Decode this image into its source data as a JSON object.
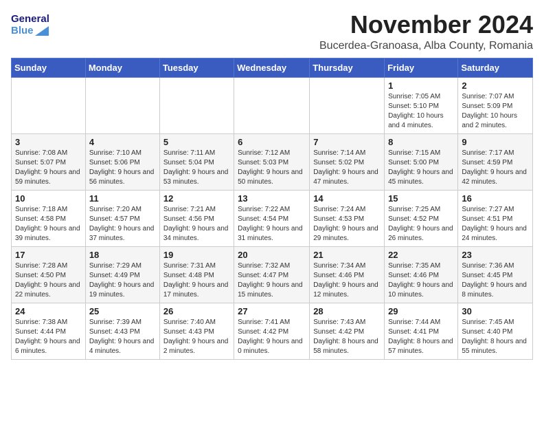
{
  "header": {
    "logo_text_general": "General",
    "logo_text_blue": "Blue",
    "month_title": "November 2024",
    "location": "Bucerdea-Granoasa, Alba County, Romania"
  },
  "days_of_week": [
    "Sunday",
    "Monday",
    "Tuesday",
    "Wednesday",
    "Thursday",
    "Friday",
    "Saturday"
  ],
  "weeks": [
    [
      {
        "day": "",
        "info": ""
      },
      {
        "day": "",
        "info": ""
      },
      {
        "day": "",
        "info": ""
      },
      {
        "day": "",
        "info": ""
      },
      {
        "day": "",
        "info": ""
      },
      {
        "day": "1",
        "info": "Sunrise: 7:05 AM\nSunset: 5:10 PM\nDaylight: 10 hours and 4 minutes."
      },
      {
        "day": "2",
        "info": "Sunrise: 7:07 AM\nSunset: 5:09 PM\nDaylight: 10 hours and 2 minutes."
      }
    ],
    [
      {
        "day": "3",
        "info": "Sunrise: 7:08 AM\nSunset: 5:07 PM\nDaylight: 9 hours and 59 minutes."
      },
      {
        "day": "4",
        "info": "Sunrise: 7:10 AM\nSunset: 5:06 PM\nDaylight: 9 hours and 56 minutes."
      },
      {
        "day": "5",
        "info": "Sunrise: 7:11 AM\nSunset: 5:04 PM\nDaylight: 9 hours and 53 minutes."
      },
      {
        "day": "6",
        "info": "Sunrise: 7:12 AM\nSunset: 5:03 PM\nDaylight: 9 hours and 50 minutes."
      },
      {
        "day": "7",
        "info": "Sunrise: 7:14 AM\nSunset: 5:02 PM\nDaylight: 9 hours and 47 minutes."
      },
      {
        "day": "8",
        "info": "Sunrise: 7:15 AM\nSunset: 5:00 PM\nDaylight: 9 hours and 45 minutes."
      },
      {
        "day": "9",
        "info": "Sunrise: 7:17 AM\nSunset: 4:59 PM\nDaylight: 9 hours and 42 minutes."
      }
    ],
    [
      {
        "day": "10",
        "info": "Sunrise: 7:18 AM\nSunset: 4:58 PM\nDaylight: 9 hours and 39 minutes."
      },
      {
        "day": "11",
        "info": "Sunrise: 7:20 AM\nSunset: 4:57 PM\nDaylight: 9 hours and 37 minutes."
      },
      {
        "day": "12",
        "info": "Sunrise: 7:21 AM\nSunset: 4:56 PM\nDaylight: 9 hours and 34 minutes."
      },
      {
        "day": "13",
        "info": "Sunrise: 7:22 AM\nSunset: 4:54 PM\nDaylight: 9 hours and 31 minutes."
      },
      {
        "day": "14",
        "info": "Sunrise: 7:24 AM\nSunset: 4:53 PM\nDaylight: 9 hours and 29 minutes."
      },
      {
        "day": "15",
        "info": "Sunrise: 7:25 AM\nSunset: 4:52 PM\nDaylight: 9 hours and 26 minutes."
      },
      {
        "day": "16",
        "info": "Sunrise: 7:27 AM\nSunset: 4:51 PM\nDaylight: 9 hours and 24 minutes."
      }
    ],
    [
      {
        "day": "17",
        "info": "Sunrise: 7:28 AM\nSunset: 4:50 PM\nDaylight: 9 hours and 22 minutes."
      },
      {
        "day": "18",
        "info": "Sunrise: 7:29 AM\nSunset: 4:49 PM\nDaylight: 9 hours and 19 minutes."
      },
      {
        "day": "19",
        "info": "Sunrise: 7:31 AM\nSunset: 4:48 PM\nDaylight: 9 hours and 17 minutes."
      },
      {
        "day": "20",
        "info": "Sunrise: 7:32 AM\nSunset: 4:47 PM\nDaylight: 9 hours and 15 minutes."
      },
      {
        "day": "21",
        "info": "Sunrise: 7:34 AM\nSunset: 4:46 PM\nDaylight: 9 hours and 12 minutes."
      },
      {
        "day": "22",
        "info": "Sunrise: 7:35 AM\nSunset: 4:46 PM\nDaylight: 9 hours and 10 minutes."
      },
      {
        "day": "23",
        "info": "Sunrise: 7:36 AM\nSunset: 4:45 PM\nDaylight: 9 hours and 8 minutes."
      }
    ],
    [
      {
        "day": "24",
        "info": "Sunrise: 7:38 AM\nSunset: 4:44 PM\nDaylight: 9 hours and 6 minutes."
      },
      {
        "day": "25",
        "info": "Sunrise: 7:39 AM\nSunset: 4:43 PM\nDaylight: 9 hours and 4 minutes."
      },
      {
        "day": "26",
        "info": "Sunrise: 7:40 AM\nSunset: 4:43 PM\nDaylight: 9 hours and 2 minutes."
      },
      {
        "day": "27",
        "info": "Sunrise: 7:41 AM\nSunset: 4:42 PM\nDaylight: 9 hours and 0 minutes."
      },
      {
        "day": "28",
        "info": "Sunrise: 7:43 AM\nSunset: 4:42 PM\nDaylight: 8 hours and 58 minutes."
      },
      {
        "day": "29",
        "info": "Sunrise: 7:44 AM\nSunset: 4:41 PM\nDaylight: 8 hours and 57 minutes."
      },
      {
        "day": "30",
        "info": "Sunrise: 7:45 AM\nSunset: 4:40 PM\nDaylight: 8 hours and 55 minutes."
      }
    ]
  ]
}
